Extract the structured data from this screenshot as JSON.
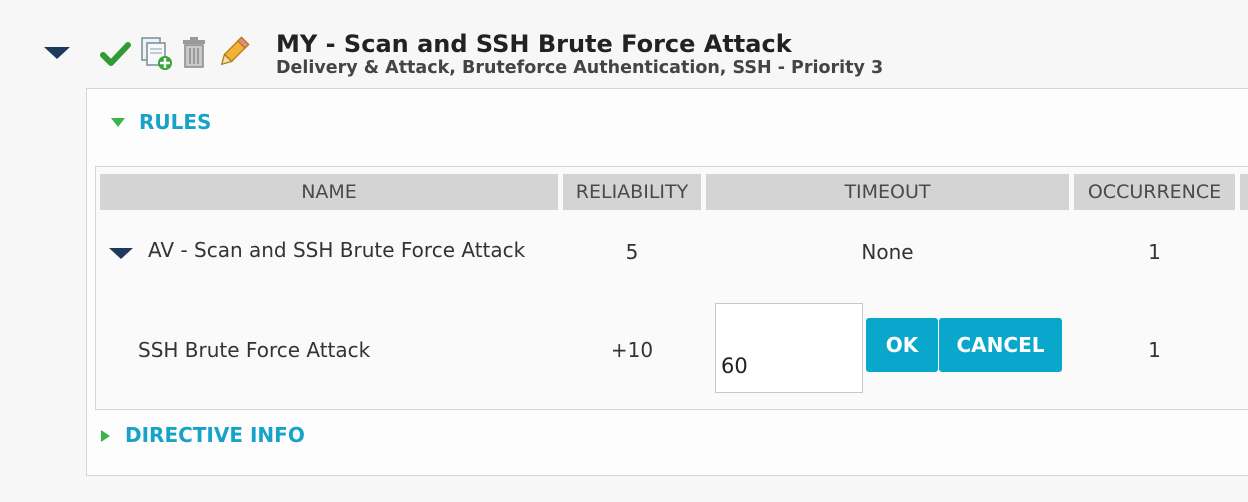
{
  "directive": {
    "title": "MY - Scan and SSH Brute Force Attack",
    "subtitle": "Delivery & Attack, Bruteforce Authentication, SSH - Priority 3"
  },
  "icons": {
    "collapse": "chevron-down-icon",
    "enable": "checkmark-icon",
    "clone": "clone-icon",
    "delete": "trash-icon",
    "edit": "pencil-icon"
  },
  "sections": {
    "rules_label": "RULES",
    "directive_info_label": "DIRECTIVE INFO"
  },
  "table": {
    "columns": [
      "NAME",
      "RELIABILITY",
      "TIMEOUT",
      "OCCURRENCE"
    ],
    "rows": [
      {
        "name": "AV - Scan and SSH Brute Force Attack",
        "reliability": "5",
        "timeout": "None",
        "occurrence": "1"
      },
      {
        "name": "SSH Brute Force Attack",
        "reliability": "+10",
        "timeout": "60",
        "occurrence": "1"
      }
    ]
  },
  "edit": {
    "timeout_value": "60",
    "ok_label": "OK",
    "cancel_label": "CANCEL"
  },
  "colors": {
    "accent": "#17a3c9",
    "button": "#0aa7cc",
    "expander": "#39b54a",
    "dark_triangle": "#1d3a5c"
  }
}
